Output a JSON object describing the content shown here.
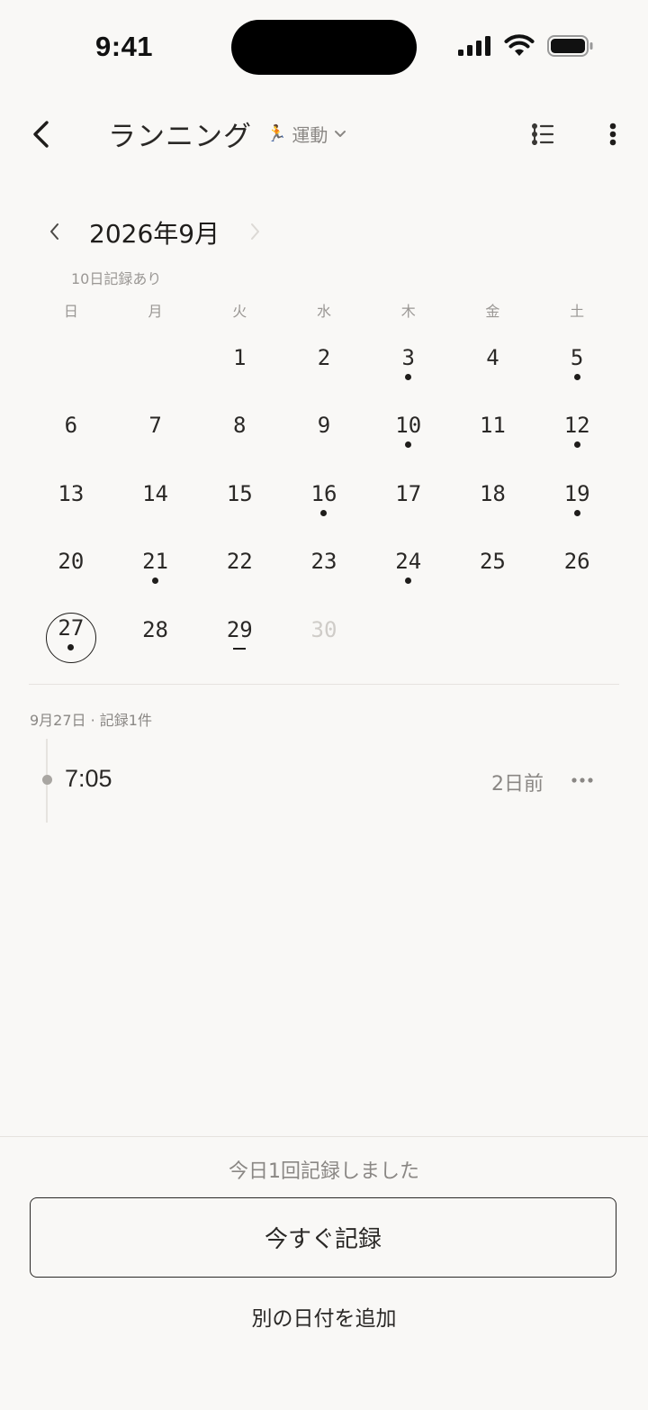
{
  "status_bar": {
    "time": "9:41"
  },
  "header": {
    "title": "ランニング",
    "category_emoji": "🏃",
    "category_label": "運動"
  },
  "calendar": {
    "month_label": "2026年9月",
    "record_summary": "10日記録あり",
    "weekdays": [
      "日",
      "月",
      "火",
      "水",
      "木",
      "金",
      "土"
    ],
    "leading_blanks": 2,
    "days": [
      {
        "label": "1",
        "dot": false
      },
      {
        "label": "2",
        "dot": false
      },
      {
        "label": "3",
        "dot": true
      },
      {
        "label": "4",
        "dot": false
      },
      {
        "label": "5",
        "dot": true
      },
      {
        "label": "6",
        "dot": false
      },
      {
        "label": "7",
        "dot": false
      },
      {
        "label": "8",
        "dot": false
      },
      {
        "label": "9",
        "dot": false
      },
      {
        "label": "10",
        "dot": true
      },
      {
        "label": "11",
        "dot": false
      },
      {
        "label": "12",
        "dot": true
      },
      {
        "label": "13",
        "dot": false
      },
      {
        "label": "14",
        "dot": false
      },
      {
        "label": "15",
        "dot": false
      },
      {
        "label": "16",
        "dot": true
      },
      {
        "label": "17",
        "dot": false
      },
      {
        "label": "18",
        "dot": false
      },
      {
        "label": "19",
        "dot": true
      },
      {
        "label": "20",
        "dot": false
      },
      {
        "label": "21",
        "dot": true
      },
      {
        "label": "22",
        "dot": false
      },
      {
        "label": "23",
        "dot": false
      },
      {
        "label": "24",
        "dot": true
      },
      {
        "label": "25",
        "dot": false
      },
      {
        "label": "26",
        "dot": false
      },
      {
        "label": "27",
        "dot": true,
        "selected": true
      },
      {
        "label": "28",
        "dot": false
      },
      {
        "label": "29",
        "dot": false,
        "today_marker": true
      },
      {
        "label": "30",
        "dot": false,
        "future": true
      }
    ]
  },
  "entries": {
    "header": "9月27日 · 記録1件",
    "items": [
      {
        "time": "7:05",
        "ago": "2日前"
      }
    ]
  },
  "footer": {
    "today_summary": "今日1回記録しました",
    "record_now_label": "今すぐ記録",
    "add_other_date_label": "別の日付を追加"
  }
}
